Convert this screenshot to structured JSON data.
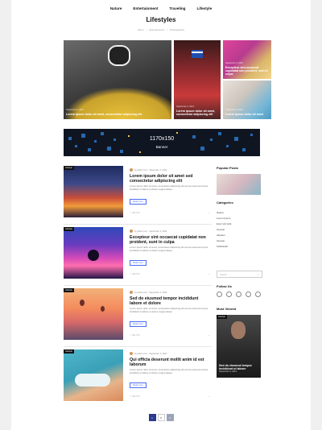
{
  "nav": {
    "items": [
      "Nature",
      "Entertainment",
      "Traveling",
      "Lifestyle"
    ]
  },
  "page_title": "Lifestyles",
  "breadcrumb": [
    "Home",
    "Entertainment",
    "Photographer"
  ],
  "hero": {
    "main": {
      "meta": "September 4, 2021",
      "title": "Lorem ipsum dolor sit amet, consectetur adipiscing elit"
    },
    "mid": {
      "meta": "September 4, 2021",
      "title": "Lorem ipsum dolor sit amet, consectetur adipiscing elit"
    },
    "top_right": {
      "meta": "September 4, 2021",
      "title": "Excepteur sint occaecat cupidatat non proident, sunt in culpa"
    },
    "bottom_right": {
      "meta": "September 4, 2021",
      "title": "Lorem ipsum dolor sit amet"
    }
  },
  "banner": {
    "size": "1170x150",
    "label": "Banner"
  },
  "posts": [
    {
      "badge": "Lifestyle",
      "author": "by Admin.com",
      "date": "September 4, 2021",
      "title": "Lorem ipsum dolor sit amet sed consectetur adipiscing elit",
      "excerpt": "Lorem ipsum dolor sit amet, consectetur adipiscing elit sed do eiusmod tempor incididunt ut labore et dolore magna aliqua.",
      "more": "Read more",
      "likes": "14",
      "comments": "3"
    },
    {
      "badge": "Lifestyle",
      "author": "by Admin.com",
      "date": "September 4, 2021",
      "title": "Excepteur sint occaecat cupidatat non proident, sunt in culpa",
      "excerpt": "Lorem ipsum dolor sit amet, consectetur adipiscing elit sed do eiusmod tempor incididunt ut labore et dolore magna aliqua.",
      "more": "Read more",
      "likes": "14",
      "comments": "3"
    },
    {
      "badge": "Lifestyle",
      "author": "by Admin.com",
      "date": "September 4, 2021",
      "title": "Sed do eiusmod tempor incididunt labore et dolore",
      "excerpt": "Lorem ipsum dolor sit amet, consectetur adipiscing elit sed do eiusmod tempor incididunt ut labore et dolore magna aliqua.",
      "more": "Read more",
      "likes": "14",
      "comments": "3"
    },
    {
      "badge": "Lifestyle",
      "author": "by Admin.com",
      "date": "September 4, 2021",
      "title": "Qui officia deserunt mollit anim id est laborum",
      "excerpt": "Lorem ipsum dolor sit amet, consectetur adipiscing elit sed do eiusmod tempor incididunt ut labore et dolore magna aliqua.",
      "more": "Read more",
      "likes": "14",
      "comments": "3"
    }
  ],
  "sidebar": {
    "popular_title": "Popular Posts",
    "categories_title": "Categories",
    "categories": [
      "Nature",
      "Lorem Ipsum",
      "Enim Vel Velit",
      "Aenean",
      "Aliquam",
      "Aenean",
      "Sollicitudin"
    ],
    "search_placeholder": "Search",
    "follow_title": "Follow Us",
    "most_viewed_title": "Most Viewed",
    "most_viewed": {
      "badge": "Lifestyle",
      "title": "Sed do eiusmod tempor incididunt ut labore",
      "date": "September 4, 2021"
    }
  },
  "pagination": [
    "1",
    "2",
    "3"
  ]
}
